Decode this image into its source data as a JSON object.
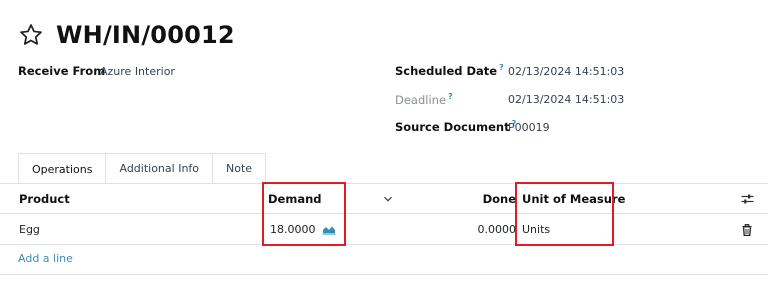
{
  "record": {
    "title": "WH/IN/00012"
  },
  "fields": {
    "receive_from_label": "Receive From",
    "receive_from_value": "Azure Interior",
    "scheduled_date_label": "Scheduled Date",
    "scheduled_date_value": "02/13/2024 14:51:03",
    "deadline_label": "Deadline",
    "deadline_value": "02/13/2024 14:51:03",
    "source_document_label": "Source Document",
    "source_document_value": "P00019",
    "help_marker": "?"
  },
  "tabs": [
    {
      "label": "Operations",
      "active": true
    },
    {
      "label": "Additional Info",
      "active": false
    },
    {
      "label": "Note",
      "active": false
    }
  ],
  "table": {
    "columns": {
      "product": "Product",
      "demand": "Demand",
      "done": "Done",
      "unit_of_measure": "Unit of Measure"
    },
    "rows": [
      {
        "product": "Egg",
        "demand": "18.0000",
        "done": "0.0000",
        "unit_of_measure": "Units"
      }
    ],
    "add_line_label": "Add a line"
  },
  "icons": {
    "favorite": "star-outline-icon",
    "forecast": "area-chart-icon",
    "delete": "trash-icon",
    "column_settings": "sliders-icon",
    "column_menu": "chevron-down-icon"
  },
  "colors": {
    "highlight": "#e01b24",
    "link": "#3d8db8",
    "help": "#2e8fb8"
  }
}
